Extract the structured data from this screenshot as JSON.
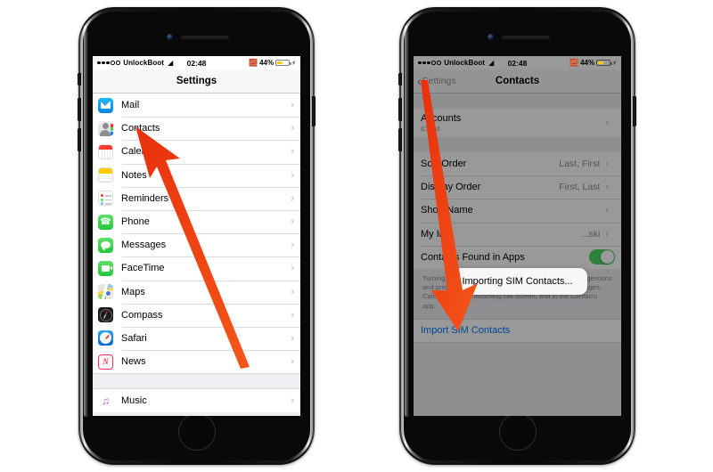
{
  "left_phone": {
    "status_bar": {
      "carrier": "UnlockBoot",
      "time": "02:48",
      "battery_percent": "44%",
      "wifi_icon": "wifi-icon",
      "bluetooth_icon": "bluetooth-icon",
      "signal_icon": "signal-dots-icon",
      "battery_icon": "battery-icon",
      "charge_icon": "lightning-bolt-icon"
    },
    "nav": {
      "title": "Settings"
    },
    "rows": [
      {
        "label": "Mail",
        "icon": "mail-icon"
      },
      {
        "label": "Contacts",
        "icon": "contacts-icon"
      },
      {
        "label": "Calendar",
        "icon": "calendar-icon"
      },
      {
        "label": "Notes",
        "icon": "notes-icon"
      },
      {
        "label": "Reminders",
        "icon": "reminders-icon"
      },
      {
        "label": "Phone",
        "icon": "phone-icon"
      },
      {
        "label": "Messages",
        "icon": "messages-icon"
      },
      {
        "label": "FaceTime",
        "icon": "facetime-icon"
      },
      {
        "label": "Maps",
        "icon": "maps-icon"
      },
      {
        "label": "Compass",
        "icon": "compass-icon"
      },
      {
        "label": "Safari",
        "icon": "safari-icon"
      },
      {
        "label": "News",
        "icon": "news-icon"
      }
    ],
    "rows_group2": [
      {
        "label": "Music",
        "icon": "music-icon"
      }
    ],
    "chevron": "›"
  },
  "right_phone": {
    "status_bar": {
      "carrier": "UnlockBoot",
      "time": "02:48",
      "battery_percent": "44%"
    },
    "nav": {
      "back_label": "Settings",
      "title": "Contacts",
      "back_icon": "chevron-left-icon"
    },
    "accounts_row": {
      "label": "Accounts",
      "sub": "iCloud"
    },
    "settings_rows": [
      {
        "label": "Sort Order",
        "value": "Last, First"
      },
      {
        "label": "Display Order",
        "value": "First, Last"
      },
      {
        "label": "Short Name",
        "value": ""
      },
      {
        "label": "My Info",
        "value": "...ski"
      }
    ],
    "toggle_row": {
      "label": "Contacts Found in Apps",
      "state": "on",
      "color": "#4cd964"
    },
    "footnote": "Turning this off will delete any unconfirmed contact suggestions and prevent suggestions from appearing in Mail, Messages, Calendar, on the incoming call screen, and in the Contacts app.",
    "import_link": "Import SIM Contacts",
    "toast": {
      "text": "Importing SIM Contacts..."
    },
    "chevron": "›"
  },
  "annotations": {
    "arrow_left": {
      "color": "#ef3b14",
      "points_to": "Contacts"
    },
    "arrow_right": {
      "color": "#ef3b14",
      "points_to": "Import SIM Contacts"
    }
  }
}
